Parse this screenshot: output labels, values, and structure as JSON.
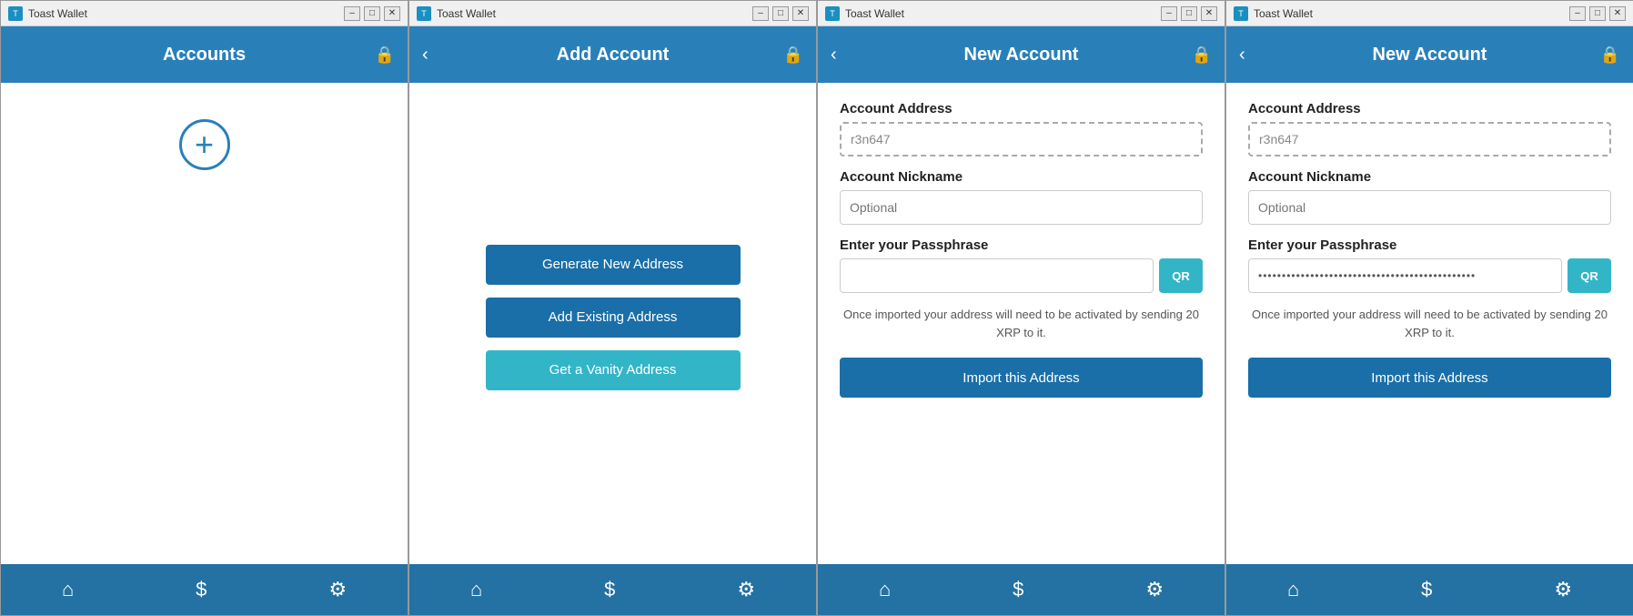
{
  "windows": [
    {
      "id": "accounts",
      "titleBar": {
        "appName": "Toast Wallet",
        "controls": [
          "minimize",
          "maximize",
          "close"
        ]
      },
      "header": {
        "title": "Accounts",
        "showBack": false,
        "showLock": true
      },
      "footer": {
        "icons": [
          "home",
          "dollar",
          "gear"
        ]
      },
      "content": {
        "type": "accounts",
        "addIcon": "+"
      }
    },
    {
      "id": "add-account",
      "titleBar": {
        "appName": "Toast Wallet",
        "controls": [
          "minimize",
          "maximize",
          "close"
        ]
      },
      "header": {
        "title": "Add Account",
        "showBack": true,
        "showLock": true
      },
      "footer": {
        "icons": [
          "home",
          "dollar",
          "gear"
        ]
      },
      "content": {
        "type": "add-account",
        "buttons": [
          {
            "label": "Generate New Address",
            "style": "dark"
          },
          {
            "label": "Add Existing Address",
            "style": "dark"
          },
          {
            "label": "Get a Vanity Address",
            "style": "cyan"
          }
        ]
      }
    },
    {
      "id": "new-account-1",
      "titleBar": {
        "appName": "Toast Wallet",
        "controls": [
          "minimize",
          "maximize",
          "close"
        ]
      },
      "header": {
        "title": "New Account",
        "showBack": true,
        "showLock": true
      },
      "footer": {
        "icons": [
          "home",
          "dollar",
          "gear"
        ]
      },
      "content": {
        "type": "new-account",
        "addressLabel": "Account Address",
        "addressValue": "r3n647",
        "addressPlaceholder": "r3n647",
        "nicknameLabel": "Account Nickname",
        "nicknamePlaceholder": "Optional",
        "passphraseLabel": "Enter your Passphrase",
        "passphraseValue": "",
        "qrLabel": "QR",
        "noticeText": "Once imported your address will need to be activated by sending 20 XRP to it.",
        "importLabel": "Import this Address",
        "passphraseHasDots": false
      }
    },
    {
      "id": "new-account-2",
      "titleBar": {
        "appName": "Toast Wallet",
        "controls": [
          "minimize",
          "maximize",
          "close"
        ]
      },
      "header": {
        "title": "New Account",
        "showBack": true,
        "showLock": true
      },
      "footer": {
        "icons": [
          "home",
          "dollar",
          "gear"
        ]
      },
      "content": {
        "type": "new-account",
        "addressLabel": "Account Address",
        "addressValue": "r3n647",
        "addressPlaceholder": "r3n647",
        "nicknameLabel": "Account Nickname",
        "nicknamePlaceholder": "Optional",
        "passphraseLabel": "Enter your Passphrase",
        "passphraseValue": "••••••••••••••••••••••••••••••••••••••••••••••••",
        "qrLabel": "QR",
        "noticeText": "Once imported your address will need to be activated by sending 20 XRP to it.",
        "importLabel": "Import this Address",
        "passphraseHasDots": true
      }
    }
  ],
  "minimizeSymbol": "–",
  "maximizeSymbol": "□",
  "closeSymbol": "✕",
  "backSymbol": "‹",
  "lockSymbol": "🔒",
  "homeSymbol": "⌂",
  "dollarSymbol": "$",
  "gearSymbol": "⚙"
}
